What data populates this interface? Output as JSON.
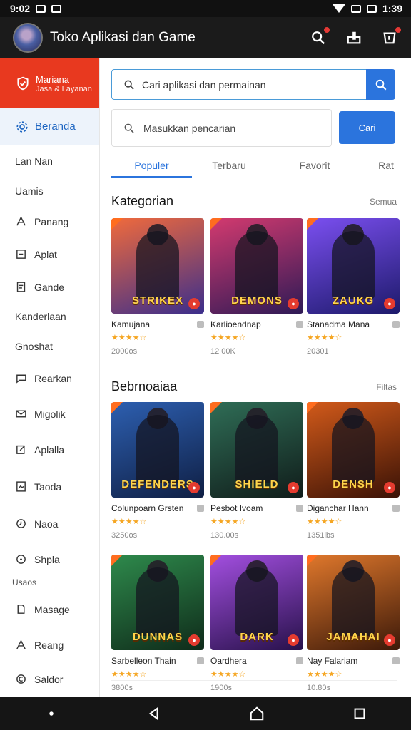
{
  "status": {
    "time": "9:02",
    "clock": "1:39"
  },
  "appbar": {
    "title": "Toko Aplikasi dan Game"
  },
  "sidebar": {
    "hero": {
      "line1": "Mariana",
      "line2": "Jasa & Layanan"
    },
    "active": "Beranda",
    "items": [
      {
        "label": "Lan Nan",
        "icon": "none-icon"
      },
      {
        "label": "Uamis",
        "icon": "none-icon"
      },
      {
        "label": "Panang",
        "icon": "person-icon"
      },
      {
        "label": "Aplat",
        "icon": "square-minus-icon"
      },
      {
        "label": "Gande",
        "icon": "document-icon"
      },
      {
        "label": "Kanderlaan",
        "icon": "none-icon"
      },
      {
        "label": "Gnoshat",
        "icon": "none-icon"
      },
      {
        "label": "Rearkan",
        "icon": "chat-icon"
      },
      {
        "label": "Migolik",
        "icon": "envelope-icon"
      },
      {
        "label": "Aplalla",
        "icon": "edit-icon"
      },
      {
        "label": "Taoda",
        "icon": "image-icon"
      },
      {
        "label": "Naoa",
        "icon": "clock-icon"
      },
      {
        "label": "Shpla",
        "icon": "circle-icon"
      },
      {
        "label": "Masage",
        "icon": "person-icon"
      },
      {
        "label": "Reang",
        "icon": "person-icon"
      },
      {
        "label": "Saldor",
        "icon": "copyright-icon"
      }
    ],
    "subheader": "Usaos"
  },
  "search": {
    "primary_placeholder": "Cari aplikasi dan permainan",
    "secondary_placeholder": "Masukkan pencarian",
    "secondary_button": "Cari"
  },
  "tabs": [
    "Populer",
    "Terbaru",
    "Favorit",
    "Rat"
  ],
  "sections": [
    {
      "title": "Kategorian",
      "more": "Semua",
      "cards": [
        {
          "name": "Kamujana",
          "rating": "★★★★☆",
          "meta": "2000os",
          "logo": "STRIKEX",
          "colors": [
            "#f06a3c",
            "#3b2e8c"
          ]
        },
        {
          "name": "Karlioendnap",
          "rating": "★★★★☆",
          "meta": "12 00K",
          "logo": "DEMONS",
          "colors": [
            "#d33a6f",
            "#2e1a56"
          ]
        },
        {
          "name": "Stanadma Mana",
          "rating": "★★★★☆",
          "meta": "20301",
          "logo": "ZAUKG",
          "colors": [
            "#7b4ff0",
            "#1d1a6b"
          ]
        }
      ]
    },
    {
      "title": "Bebrnoaiaa",
      "more": "Filtas",
      "cards": [
        {
          "name": "Colunpoarn Grsten",
          "rating": "★★★★☆",
          "meta": "3250os",
          "logo": "DEFENDERS",
          "colors": [
            "#2d5fb0",
            "#0f1f44"
          ]
        },
        {
          "name": "Pesbot Ivoam",
          "rating": "★★★★☆",
          "meta": "130.00s",
          "logo": "SHIELD",
          "colors": [
            "#2f6d56",
            "#101c1a"
          ]
        },
        {
          "name": "Diganchar Hann",
          "rating": "★★★★☆",
          "meta": "1351ibs",
          "logo": "DENSH",
          "colors": [
            "#d25a1a",
            "#3a1206"
          ]
        }
      ]
    },
    {
      "title": "",
      "more": "",
      "cards": [
        {
          "name": "Sarbelleon Thain",
          "rating": "★★★★☆",
          "meta": "3800s",
          "logo": "DUNNAS",
          "colors": [
            "#2e8a4c",
            "#0f2b1a"
          ]
        },
        {
          "name": "Oardhera",
          "rating": "★★★★☆",
          "meta": "1900s",
          "logo": "DARK",
          "colors": [
            "#a34fe0",
            "#27114a"
          ]
        },
        {
          "name": "Nay Falariam",
          "rating": "★★★★☆",
          "meta": "10.80s",
          "logo": "JAMAHAI",
          "colors": [
            "#e0782c",
            "#3c1909"
          ]
        }
      ]
    }
  ]
}
